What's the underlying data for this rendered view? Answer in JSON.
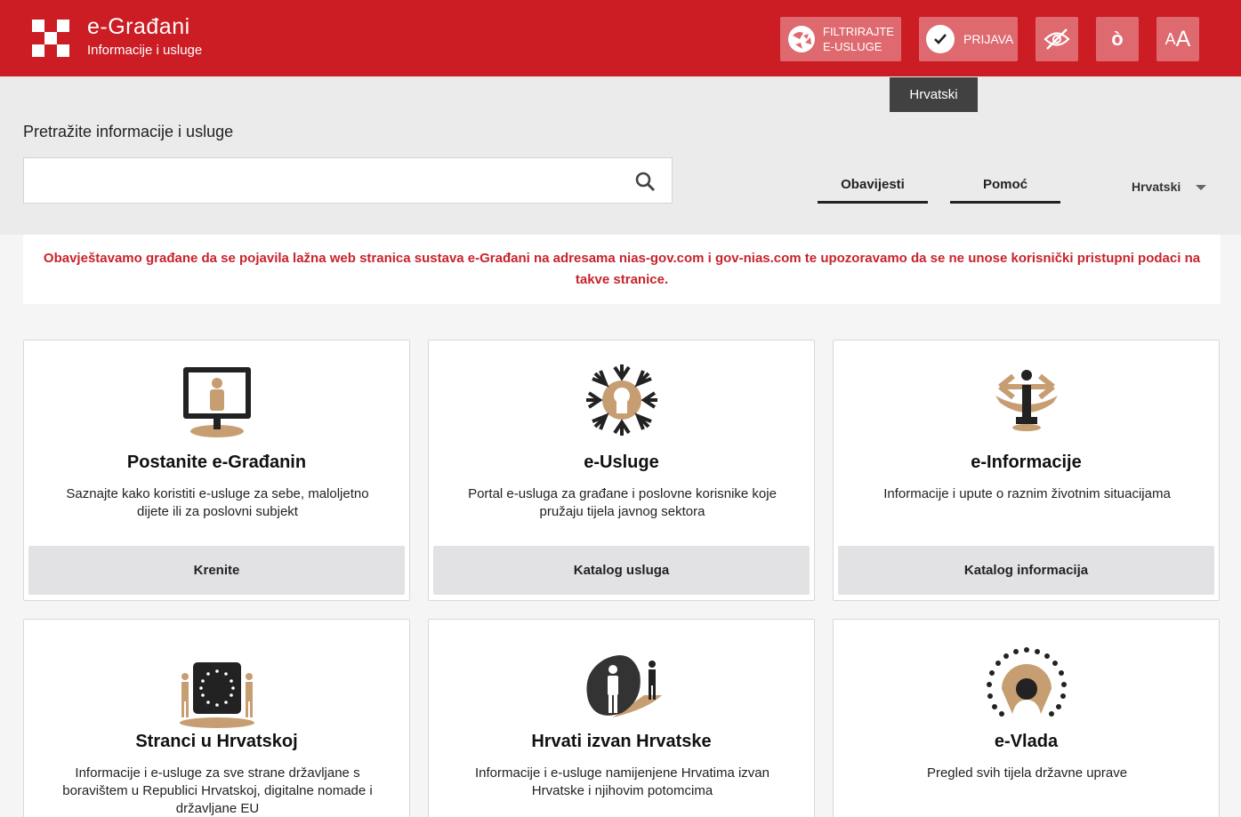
{
  "header": {
    "title": "e-Građani",
    "subtitle": "Informacije i usluge",
    "filter_label_line1": "FILTRIRAJTE",
    "filter_label_line2": "E-USLUGE",
    "login_label": "PRIJAVA",
    "hide_images_icon": "eye-slash-icon",
    "dyslexia_icon": "dyslexic-font-icon",
    "font_size_small": "A",
    "font_size_big": "A",
    "accent_color": "#cc1c24"
  },
  "tooltip": {
    "text": "Hrvatski"
  },
  "search": {
    "title": "Pretražite informacije i usluge",
    "value": "",
    "placeholder": ""
  },
  "nav": {
    "notifications": "Obavijesti",
    "help": "Pomoć",
    "language": "Hrvatski"
  },
  "notice": {
    "text": "Obavještavamo građane da se pojavila lažna web stranica sustava e-Građani na adresama nias-gov.com i gov-nias.com te upozoravamo da se ne unose korisnički pristupni podaci na takve stranice.",
    "color": "#c8232b"
  },
  "cards": [
    {
      "title": "Postanite e-Građanin",
      "desc": "Saznajte kako koristiti e-usluge za sebe, maloljetno dijete ili za poslovni subjekt",
      "cta": "Krenite",
      "icon": "computer-citizen-icon"
    },
    {
      "title": "e-Usluge",
      "desc": "Portal e-usluga za građane i poslovne korisnike koje pružaju tijela javnog sektora",
      "cta": "Katalog usluga",
      "icon": "services-network-icon"
    },
    {
      "title": "e-Informacije",
      "desc": "Informacije i upute o raznim životnim situacijama",
      "cta": "Katalog informacija",
      "icon": "information-icon"
    },
    {
      "title": "Stranci u Hrvatskoj",
      "desc": "Informacije i e-usluge za sve strane državljane s boravištem u Republici Hrvatskoj, digitalne nomade i državljane EU",
      "icon": "eu-flag-people-icon"
    },
    {
      "title": "Hrvati izvan Hrvatske",
      "desc": "Informacije i e-usluge namijenjene Hrvatima izvan Hrvatske i njihovim potomcima",
      "icon": "diaspora-people-icon"
    },
    {
      "title": "e-Vlada",
      "desc": "Pregled svih tijela državne uprave",
      "icon": "government-table-icon"
    }
  ]
}
